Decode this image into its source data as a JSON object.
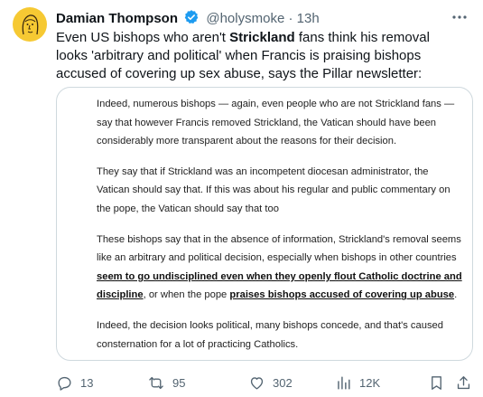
{
  "author": {
    "name": "Damian Thompson",
    "handle": "@holysmoke",
    "dot": "·",
    "time": "13h"
  },
  "tweet": {
    "part1": "Even US bishops who aren't ",
    "bold": "Strickland",
    "part2": " fans think his removal looks 'arbitrary and political' when Francis is praising bishops accused of covering up sex abuse, says the Pillar newsletter:"
  },
  "quote": {
    "p1": "Indeed, numerous bishops — again, even people who are not Strickland fans — say that however Francis removed Strickland, the Vatican should have been considerably more transparent about the reasons for their decision.",
    "p2": "They say that if Strickland was an incompetent diocesan administrator, the Vatican should say that. If this was about his regular and public commentary on the pope, the Vatican should say that too",
    "p3_a": "These bishops say that in the absence of information, Strickland's removal seems like an arbitrary and political decision, especially when bishops in other countries ",
    "p3_link1": "seem to go undisciplined even when they openly flout Catholic doctrine and discipline",
    "p3_b": ", or when the pope ",
    "p3_link2": "praises bishops accused of covering up abuse",
    "p3_c": ".",
    "p4": "Indeed, the decision looks political, many bishops concede, and that's caused consternation for a lot of practicing Catholics."
  },
  "actions": {
    "replies": "13",
    "reposts": "95",
    "likes": "302",
    "views": "12K"
  },
  "colors": {
    "verified": "#1d9bf0",
    "muted": "#536471",
    "border": "#cfd9de",
    "avatar_bg": "#f6c933"
  },
  "icons": [
    "verified-badge-icon",
    "more-icon",
    "reply-icon",
    "repost-icon",
    "like-icon",
    "views-icon",
    "bookmark-icon",
    "share-icon"
  ]
}
